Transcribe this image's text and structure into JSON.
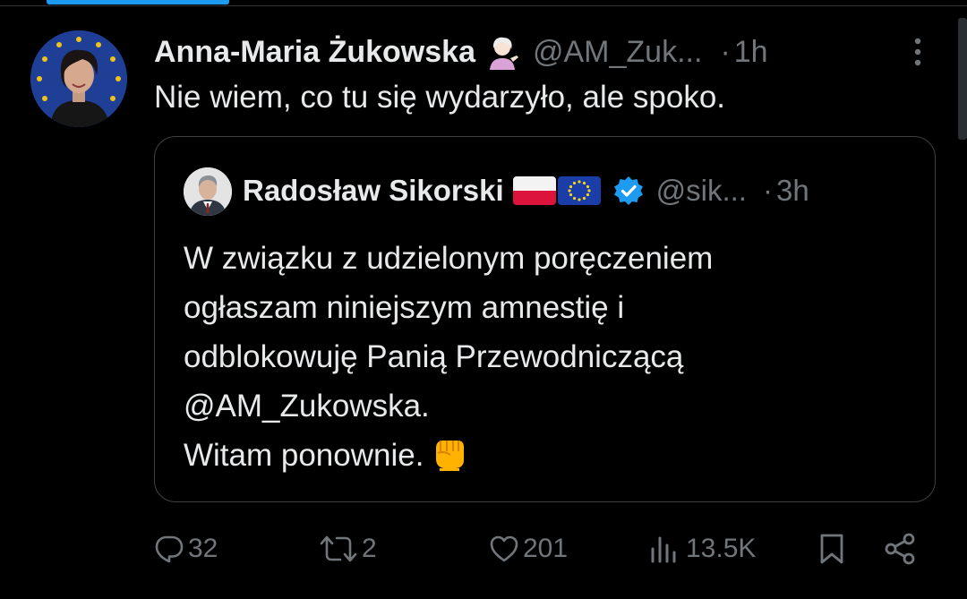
{
  "tweet": {
    "author_name": "Anna-Maria Żukowska",
    "author_handle": "@AM_Zuk...",
    "separator": "·",
    "time": "1h",
    "text": "Nie wiem, co tu się wydarzyło, ale spoko.",
    "author_emoji": "woman-tipping-hand-icon"
  },
  "quoted_tweet": {
    "author_name": "Radosław Sikorski",
    "author_handle": "@sik...",
    "separator": "·",
    "time": "3h",
    "flags": [
      "poland-flag-icon",
      "eu-flag-icon"
    ],
    "verified": true,
    "lines": [
      "W związku z udzielonym poręczeniem",
      "ogłaszam niniejszym amnestię i",
      "odblokowuję Panią Przewodniczącą",
      "@AM_Zukowska.",
      "Witam ponownie."
    ],
    "trailing_emoji": "oncoming-fist-icon"
  },
  "actions": {
    "replies": "32",
    "reposts": "2",
    "likes": "201",
    "views": "13.5K"
  },
  "colors": {
    "background": "#000000",
    "text_primary": "#e7e9ea",
    "text_secondary": "#71767b",
    "border": "#3e4144",
    "accent": "#1d9bf0"
  }
}
